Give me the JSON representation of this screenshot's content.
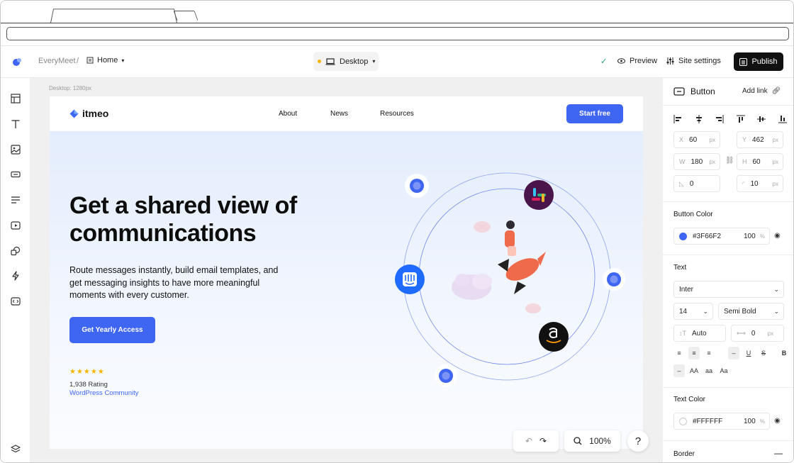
{
  "app": {
    "site_name": "EveryMeet",
    "breadcrumb_sep": "/",
    "page": "Home",
    "device": "Desktop",
    "preview": "Preview",
    "site_settings": "Site settings",
    "publish": "Publish",
    "canvas_label": "Desktop: 1280px",
    "zoom": "100%",
    "help": "?"
  },
  "site": {
    "brand": "itmeo",
    "nav": [
      "About",
      "News",
      "Resources"
    ],
    "start": "Start free",
    "headline": "Get a shared view of communications",
    "subtext": "Route messages instantly, build email templates, and get messaging insights to have more meaningful moments with every customer.",
    "cta": "Get Yearly Access",
    "stars": "★★★★★",
    "rating": "1,938 Rating",
    "community": "WordPress Community"
  },
  "panel": {
    "title": "Button",
    "add_link": "Add link",
    "x_label": "X",
    "x": "60",
    "y_label": "Y",
    "y": "462",
    "w_label": "W",
    "w": "180",
    "h_label": "H",
    "h": "60",
    "rotation": "0",
    "radius": "10",
    "unit": "px",
    "button_color_label": "Button Color",
    "button_color": "#3F66F2",
    "button_opacity": "100",
    "pct": "%",
    "text_label": "Text",
    "font": "Inter",
    "size": "14",
    "weight": "Semi Bold",
    "line_height": "Auto",
    "letter_spacing": "0",
    "case_aa1": "AA",
    "case_aa2": "aa",
    "case_aa3": "Aa",
    "bold": "B",
    "text_color_label": "Text Color",
    "text_color": "#FFFFFF",
    "text_opacity": "100",
    "border_label": "Border"
  },
  "colors": {
    "accent": "#3f66f2",
    "publish_bg": "#111111",
    "star": "#f5b400"
  }
}
